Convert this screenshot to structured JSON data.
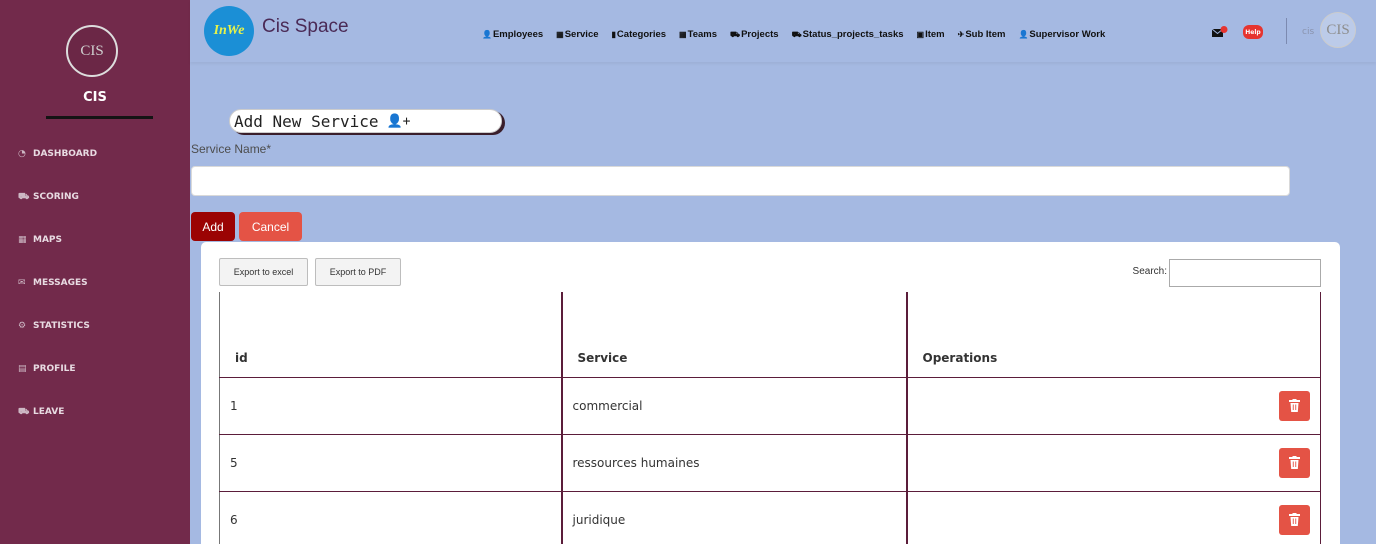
{
  "sidebar": {
    "logo_text": "CIS",
    "brand": "CIS",
    "items": [
      {
        "label": "DASHBOARD",
        "icon": "dashboard-icon"
      },
      {
        "label": "SCORING",
        "icon": "car-icon"
      },
      {
        "label": "MAPS",
        "icon": "map-icon"
      },
      {
        "label": "MESSAGES",
        "icon": "envelope-icon"
      },
      {
        "label": "STATISTICS",
        "icon": "gear-icon"
      },
      {
        "label": "PROFILE",
        "icon": "id-card-icon"
      },
      {
        "label": "LEAVE",
        "icon": "car-icon"
      }
    ]
  },
  "topbar": {
    "logo_text": "InWe",
    "title": "Cis Space",
    "nav": [
      {
        "label": "Employees",
        "icon": "user-icon"
      },
      {
        "label": "Service",
        "icon": "table-icon"
      },
      {
        "label": "Categories",
        "icon": "clipboard-icon"
      },
      {
        "label": "Teams",
        "icon": "table-icon"
      },
      {
        "label": "Projects",
        "icon": "car-icon"
      },
      {
        "label": "Status_projects_tasks",
        "icon": "car-icon"
      },
      {
        "label": "Item",
        "icon": "image-icon"
      },
      {
        "label": "Sub Item",
        "icon": "plane-icon"
      },
      {
        "label": "Supervisor Work",
        "icon": "user-icon"
      }
    ],
    "help_label": "Help",
    "user_name": "cis",
    "avatar_text": "CIS"
  },
  "form": {
    "header": "Add New Service",
    "field_label": "Service Name*",
    "field_value": "",
    "add_label": "Add",
    "cancel_label": "Cancel"
  },
  "panel": {
    "export_excel": "Export to excel",
    "export_pdf": "Export to PDF",
    "search_label": "Search:",
    "columns": [
      "id",
      "Service",
      "Operations"
    ],
    "rows": [
      {
        "id": "1",
        "service": "commercial"
      },
      {
        "id": "5",
        "service": "ressources humaines"
      },
      {
        "id": "6",
        "service": "juridique"
      }
    ]
  },
  "colors": {
    "sidebar": "#722a4b",
    "background": "#a5b9e2",
    "add_button": "#9b0303",
    "cancel_button": "#e45345",
    "delete_button": "#e45345"
  }
}
